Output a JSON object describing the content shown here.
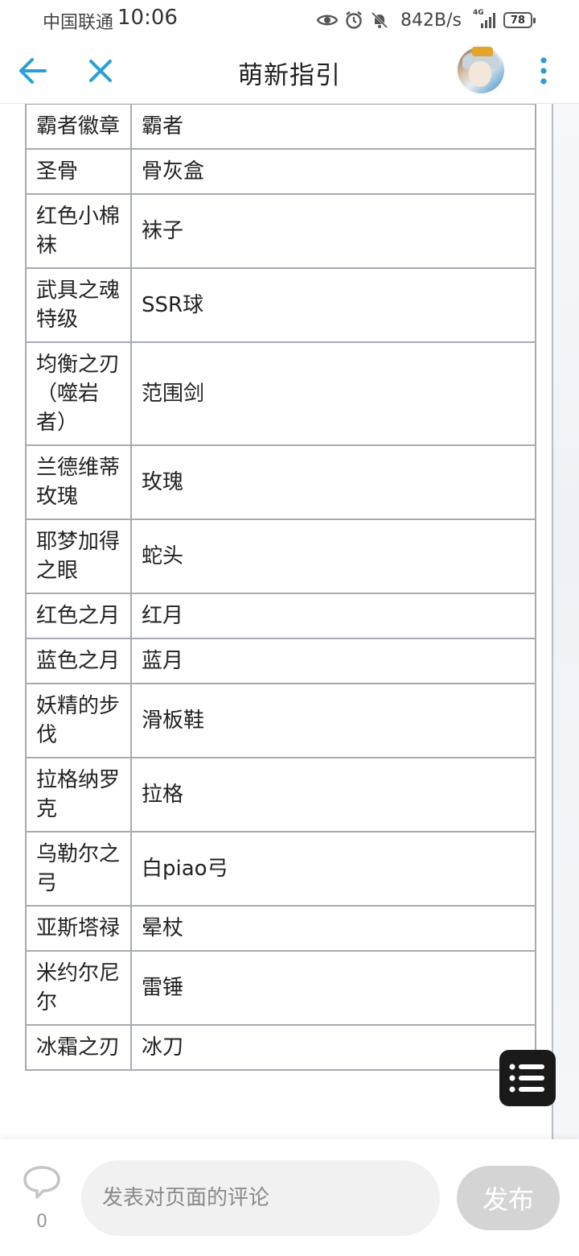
{
  "status_bar": {
    "carrier": "中国联通",
    "time": "10:06",
    "net_speed": "842B/s",
    "network_type": "4G",
    "battery": "78",
    "icons": [
      "eye-icon",
      "alarm-icon",
      "bell-muted-icon",
      "signal-icon"
    ]
  },
  "header": {
    "title": "萌新指引",
    "icons": [
      "back-arrow-icon",
      "close-icon",
      "more-vertical-icon"
    ],
    "accent_color": "#2a9fd6"
  },
  "table": {
    "rows": [
      {
        "item": "霸者徽章",
        "alias": "霸者"
      },
      {
        "item": "圣骨",
        "alias": "骨灰盒"
      },
      {
        "item": "红色小棉袜",
        "alias": "袜子"
      },
      {
        "item": "武具之魂特级",
        "alias": "SSR球"
      },
      {
        "item": "均衡之刃（噬岩者）",
        "alias": "范围剑"
      },
      {
        "item": "兰德维蒂玫瑰",
        "alias": "玫瑰"
      },
      {
        "item": "耶梦加得之眼",
        "alias": "蛇头"
      },
      {
        "item": "红色之月",
        "alias": "红月"
      },
      {
        "item": "蓝色之月",
        "alias": "蓝月"
      },
      {
        "item": "妖精的步伐",
        "alias": "滑板鞋"
      },
      {
        "item": "拉格纳罗克",
        "alias": "拉格"
      },
      {
        "item": "乌勒尔之弓",
        "alias": "白piao弓"
      },
      {
        "item": "亚斯塔禄",
        "alias": "晕杖"
      },
      {
        "item": "米约尔尼尔",
        "alias": "雷锤"
      },
      {
        "item": "冰霜之刃",
        "alias": "冰刀"
      }
    ]
  },
  "float_menu": {
    "icon": "list-menu-icon"
  },
  "bottom_bar": {
    "comment_icon": "comment-bubble-icon",
    "comment_count": "0",
    "input_placeholder": "发表对页面的评论",
    "publish_label": "发布"
  }
}
